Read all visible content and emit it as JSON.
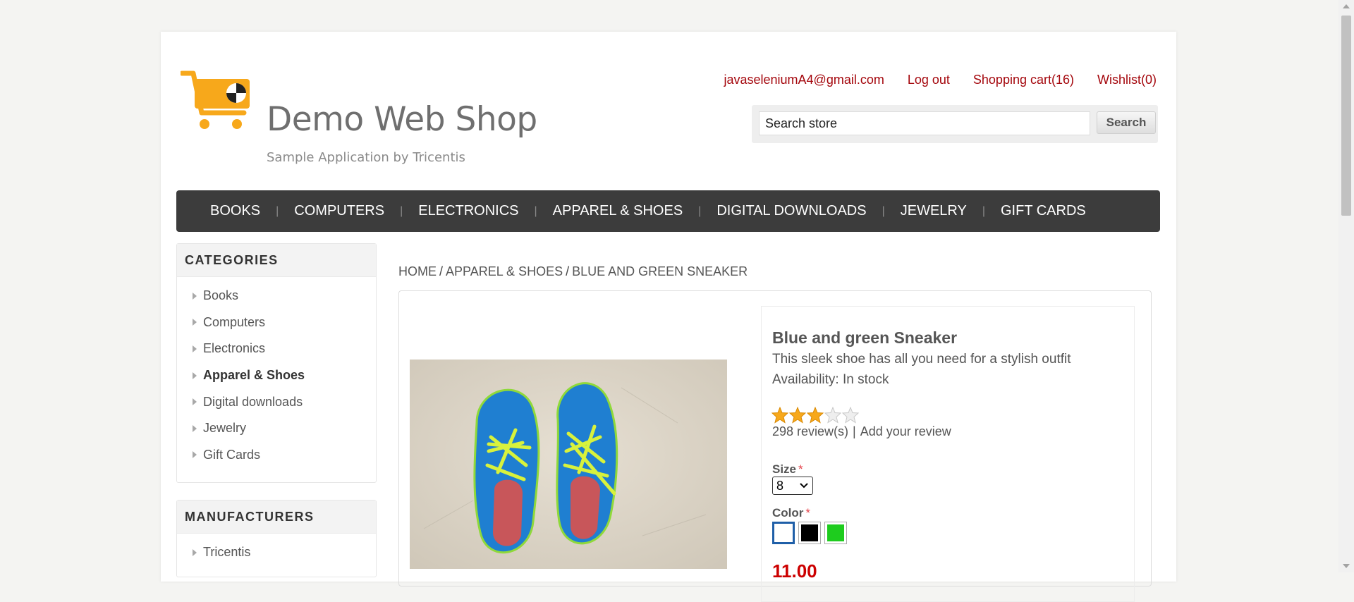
{
  "header": {
    "logo_title": "Demo Web Shop",
    "logo_subtitle": "Sample Application by Tricentis",
    "links": {
      "account": "javaseleniumA4@gmail.com",
      "logout": "Log out",
      "cart": "Shopping cart(16)",
      "wishlist": "Wishlist(0)"
    },
    "search": {
      "value": "Search store",
      "button": "Search"
    }
  },
  "menu": [
    "BOOKS",
    "COMPUTERS",
    "ELECTRONICS",
    "APPAREL & SHOES",
    "DIGITAL DOWNLOADS",
    "JEWELRY",
    "GIFT CARDS"
  ],
  "sidebar": {
    "categories_title": "CATEGORIES",
    "categories": [
      "Books",
      "Computers",
      "Electronics",
      "Apparel & Shoes",
      "Digital downloads",
      "Jewelry",
      "Gift Cards"
    ],
    "active_category": "Apparel & Shoes",
    "manufacturers_title": "MANUFACTURERS",
    "manufacturers": [
      "Tricentis"
    ]
  },
  "breadcrumb": [
    "HOME",
    "APPAREL & SHOES",
    "BLUE AND GREEN SNEAKER"
  ],
  "product": {
    "name": "Blue and green Sneaker",
    "description": "This sleek shoe has all you need for a stylish outfit",
    "availability": "Availability: In stock",
    "rating": 3,
    "rating_max": 5,
    "reviews": "298 review(s)",
    "add_review": "Add your review",
    "size_label": "Size",
    "size_value": "8",
    "color_label": "Color",
    "required_mark": "*",
    "colors": [
      "#ffffff",
      "#000000",
      "#1ecc1e"
    ],
    "price": "11.00"
  },
  "colors": {
    "accent": "#a4060c",
    "nav_bg": "#3c3c3c",
    "star": "#f7a81b"
  }
}
